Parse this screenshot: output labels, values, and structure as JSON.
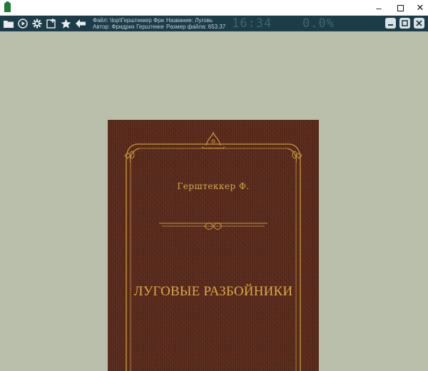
{
  "window": {
    "icon": "book-icon",
    "controls": {
      "minimize": "–",
      "close": "✕"
    }
  },
  "toolbar": {
    "icons": [
      "folder-icon",
      "play-icon",
      "gear-icon",
      "add-bookmark-icon",
      "star-icon",
      "back-arrow-icon"
    ],
    "file_line": "Файл: \\top\\Герштеккер Фри",
    "author_line": "Автор: Фридрих Герштеккер",
    "title_line": "Название:       Луговь",
    "size_line": "Размер файла: 653.37",
    "clock": "16:34",
    "progress": "0.0%",
    "right_buttons": [
      "minimize-panel-icon",
      "restore-panel-icon",
      "close-panel-icon"
    ]
  },
  "book": {
    "author": "Герштеккер Ф.",
    "title": "ЛУГОВЫЕ РАЗБОЙНИКИ"
  },
  "colors": {
    "toolbar_bg": "#1c3c49",
    "viewer_bg": "#b9bfaa",
    "cover_bg": "#5b2a1b",
    "cover_gold": "#d8a94a"
  }
}
